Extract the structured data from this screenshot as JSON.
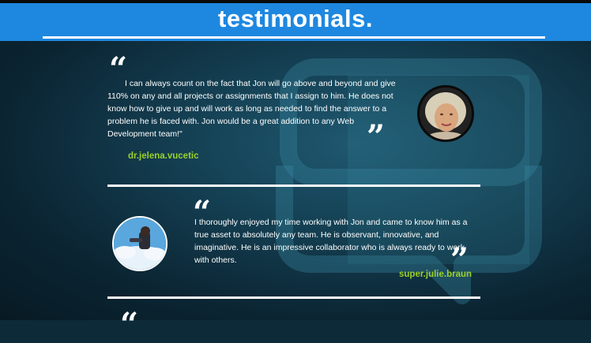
{
  "header": {
    "title": "testimonials."
  },
  "testimonials": [
    {
      "text": "I can always count on the fact that Jon will go above and beyond and give 110% on any and all projects or assignments that I assign to him. He does not know how to give up and will work as long as needed to find the answer to a problem he is faced with. Jon would be a great addition to any Web Development team!\"",
      "author": "dr.jelena.vucetic"
    },
    {
      "text": "I thoroughly enjoyed my time working with Jon and came to know him as a true asset to absolutely any team. He is observant, innovative, and imaginative. He is an impressive collaborator who is always ready to work with others.",
      "author": "super.julie.braun"
    }
  ],
  "quote_glyphs": {
    "open": "“",
    "close": "”"
  },
  "colors": {
    "header": "#1e88e0",
    "author": "#9bd12a",
    "background": "#0d2a38"
  }
}
